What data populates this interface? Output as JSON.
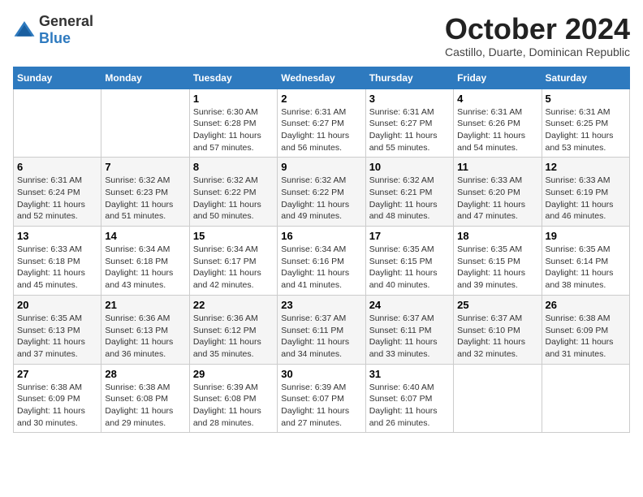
{
  "logo": {
    "general": "General",
    "blue": "Blue"
  },
  "title": {
    "month": "October 2024",
    "location": "Castillo, Duarte, Dominican Republic"
  },
  "weekdays": [
    "Sunday",
    "Monday",
    "Tuesday",
    "Wednesday",
    "Thursday",
    "Friday",
    "Saturday"
  ],
  "weeks": [
    [
      {
        "day": "",
        "info": ""
      },
      {
        "day": "",
        "info": ""
      },
      {
        "day": "1",
        "info": "Sunrise: 6:30 AM\nSunset: 6:28 PM\nDaylight: 11 hours\nand 57 minutes."
      },
      {
        "day": "2",
        "info": "Sunrise: 6:31 AM\nSunset: 6:27 PM\nDaylight: 11 hours\nand 56 minutes."
      },
      {
        "day": "3",
        "info": "Sunrise: 6:31 AM\nSunset: 6:27 PM\nDaylight: 11 hours\nand 55 minutes."
      },
      {
        "day": "4",
        "info": "Sunrise: 6:31 AM\nSunset: 6:26 PM\nDaylight: 11 hours\nand 54 minutes."
      },
      {
        "day": "5",
        "info": "Sunrise: 6:31 AM\nSunset: 6:25 PM\nDaylight: 11 hours\nand 53 minutes."
      }
    ],
    [
      {
        "day": "6",
        "info": "Sunrise: 6:31 AM\nSunset: 6:24 PM\nDaylight: 11 hours\nand 52 minutes."
      },
      {
        "day": "7",
        "info": "Sunrise: 6:32 AM\nSunset: 6:23 PM\nDaylight: 11 hours\nand 51 minutes."
      },
      {
        "day": "8",
        "info": "Sunrise: 6:32 AM\nSunset: 6:22 PM\nDaylight: 11 hours\nand 50 minutes."
      },
      {
        "day": "9",
        "info": "Sunrise: 6:32 AM\nSunset: 6:22 PM\nDaylight: 11 hours\nand 49 minutes."
      },
      {
        "day": "10",
        "info": "Sunrise: 6:32 AM\nSunset: 6:21 PM\nDaylight: 11 hours\nand 48 minutes."
      },
      {
        "day": "11",
        "info": "Sunrise: 6:33 AM\nSunset: 6:20 PM\nDaylight: 11 hours\nand 47 minutes."
      },
      {
        "day": "12",
        "info": "Sunrise: 6:33 AM\nSunset: 6:19 PM\nDaylight: 11 hours\nand 46 minutes."
      }
    ],
    [
      {
        "day": "13",
        "info": "Sunrise: 6:33 AM\nSunset: 6:18 PM\nDaylight: 11 hours\nand 45 minutes."
      },
      {
        "day": "14",
        "info": "Sunrise: 6:34 AM\nSunset: 6:18 PM\nDaylight: 11 hours\nand 43 minutes."
      },
      {
        "day": "15",
        "info": "Sunrise: 6:34 AM\nSunset: 6:17 PM\nDaylight: 11 hours\nand 42 minutes."
      },
      {
        "day": "16",
        "info": "Sunrise: 6:34 AM\nSunset: 6:16 PM\nDaylight: 11 hours\nand 41 minutes."
      },
      {
        "day": "17",
        "info": "Sunrise: 6:35 AM\nSunset: 6:15 PM\nDaylight: 11 hours\nand 40 minutes."
      },
      {
        "day": "18",
        "info": "Sunrise: 6:35 AM\nSunset: 6:15 PM\nDaylight: 11 hours\nand 39 minutes."
      },
      {
        "day": "19",
        "info": "Sunrise: 6:35 AM\nSunset: 6:14 PM\nDaylight: 11 hours\nand 38 minutes."
      }
    ],
    [
      {
        "day": "20",
        "info": "Sunrise: 6:35 AM\nSunset: 6:13 PM\nDaylight: 11 hours\nand 37 minutes."
      },
      {
        "day": "21",
        "info": "Sunrise: 6:36 AM\nSunset: 6:13 PM\nDaylight: 11 hours\nand 36 minutes."
      },
      {
        "day": "22",
        "info": "Sunrise: 6:36 AM\nSunset: 6:12 PM\nDaylight: 11 hours\nand 35 minutes."
      },
      {
        "day": "23",
        "info": "Sunrise: 6:37 AM\nSunset: 6:11 PM\nDaylight: 11 hours\nand 34 minutes."
      },
      {
        "day": "24",
        "info": "Sunrise: 6:37 AM\nSunset: 6:11 PM\nDaylight: 11 hours\nand 33 minutes."
      },
      {
        "day": "25",
        "info": "Sunrise: 6:37 AM\nSunset: 6:10 PM\nDaylight: 11 hours\nand 32 minutes."
      },
      {
        "day": "26",
        "info": "Sunrise: 6:38 AM\nSunset: 6:09 PM\nDaylight: 11 hours\nand 31 minutes."
      }
    ],
    [
      {
        "day": "27",
        "info": "Sunrise: 6:38 AM\nSunset: 6:09 PM\nDaylight: 11 hours\nand 30 minutes."
      },
      {
        "day": "28",
        "info": "Sunrise: 6:38 AM\nSunset: 6:08 PM\nDaylight: 11 hours\nand 29 minutes."
      },
      {
        "day": "29",
        "info": "Sunrise: 6:39 AM\nSunset: 6:08 PM\nDaylight: 11 hours\nand 28 minutes."
      },
      {
        "day": "30",
        "info": "Sunrise: 6:39 AM\nSunset: 6:07 PM\nDaylight: 11 hours\nand 27 minutes."
      },
      {
        "day": "31",
        "info": "Sunrise: 6:40 AM\nSunset: 6:07 PM\nDaylight: 11 hours\nand 26 minutes."
      },
      {
        "day": "",
        "info": ""
      },
      {
        "day": "",
        "info": ""
      }
    ]
  ]
}
